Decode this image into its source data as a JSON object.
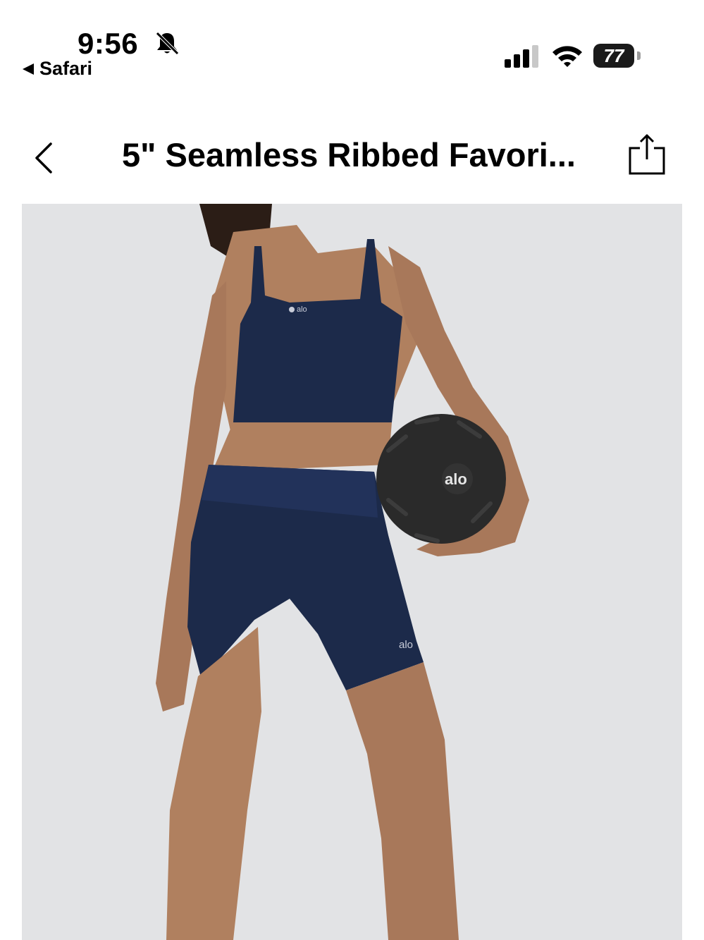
{
  "status_bar": {
    "time": "9:56",
    "back_app_label": "Safari",
    "battery_level": "77",
    "icons": [
      "bell-slash-icon",
      "cellular-signal-icon",
      "wifi-icon",
      "battery-icon"
    ]
  },
  "navigation": {
    "title": "5\" Seamless Ribbed Favori...",
    "back_icon": "chevron-left-icon",
    "share_icon": "share-icon"
  },
  "product_image": {
    "brand_marks": [
      "alo",
      "alo",
      "alo"
    ],
    "colors": {
      "background": "#e2e3e5",
      "garment": "#1c2a4a",
      "skin": "#b0805f",
      "ball": "#2a2a2a"
    }
  }
}
